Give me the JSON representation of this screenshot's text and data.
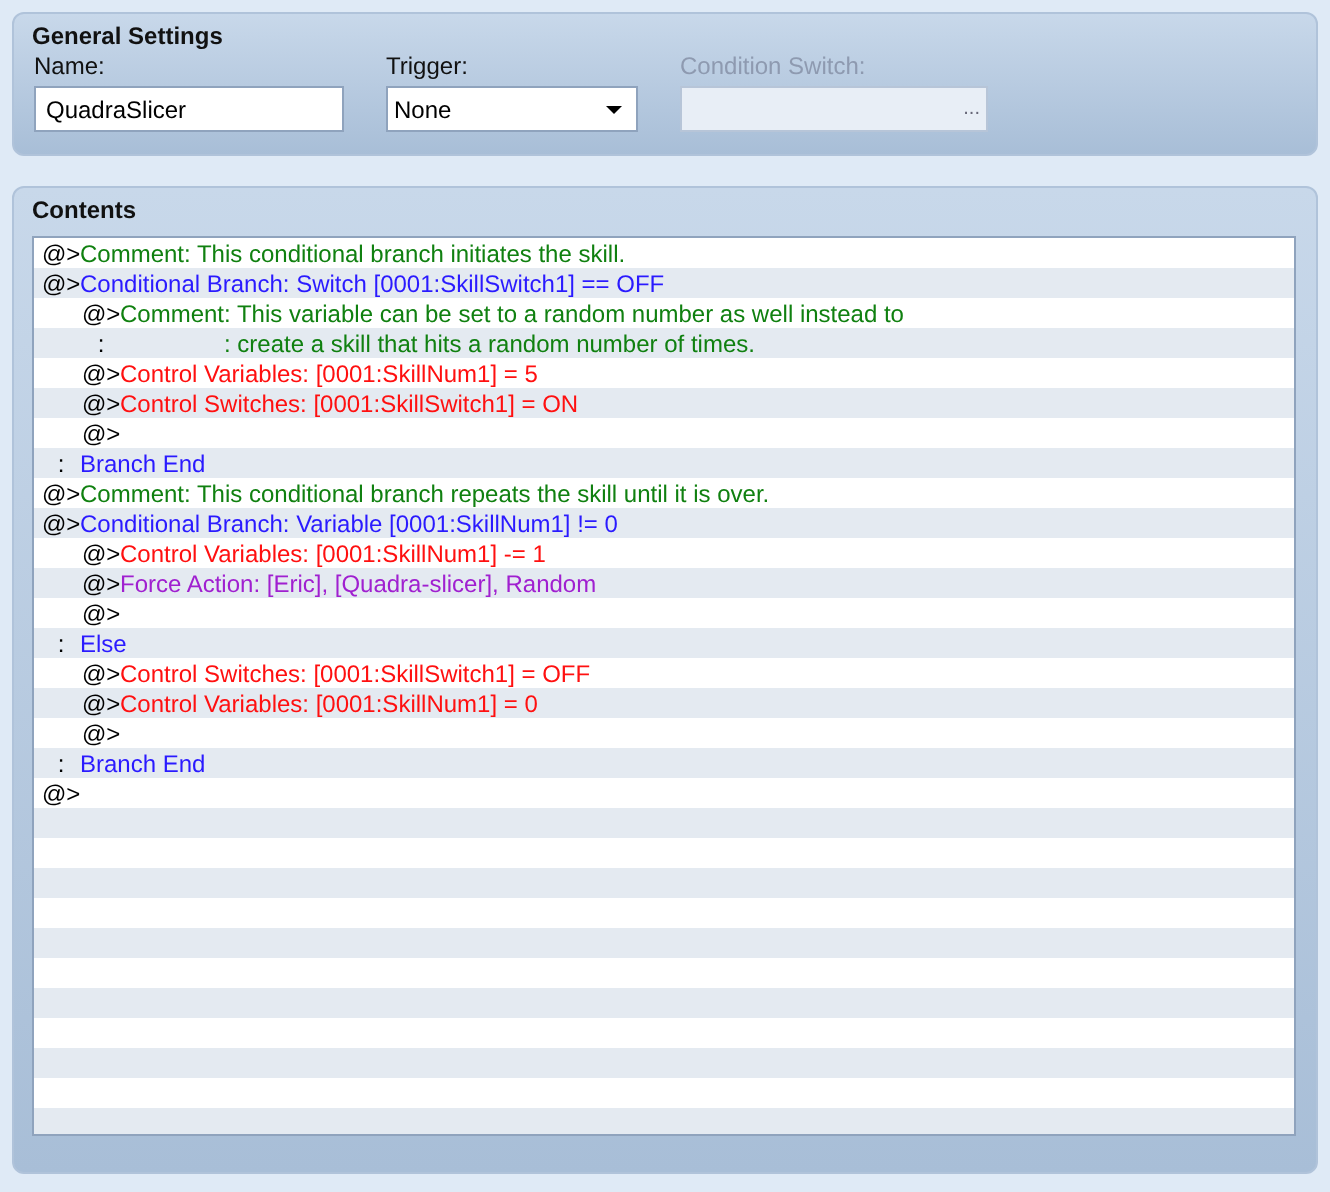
{
  "general_settings": {
    "title": "General Settings",
    "name": {
      "label": "Name:",
      "value": "QuadraSlicer"
    },
    "trigger": {
      "label": "Trigger:",
      "value": "None"
    },
    "condition_switch": {
      "label": "Condition Switch:",
      "button": "...",
      "disabled": true
    }
  },
  "contents": {
    "title": "Contents",
    "commands": [
      {
        "kind": "comment",
        "marker": "@>",
        "text": "Comment: This conditional branch initiates the skill."
      },
      {
        "kind": "branch",
        "marker": "@>",
        "text": "Conditional Branch: Switch [0001:SkillSwitch1] == OFF",
        "children": [
          {
            "kind": "comment",
            "marker": "@>",
            "text": "Comment: This variable can be set to a random number as well instead to",
            "continuation": {
              "marker": ":",
              "text": ": create a skill that hits a random number of times."
            }
          },
          {
            "kind": "control",
            "marker": "@>",
            "text": "Control Variables: [0001:SkillNum1] = 5"
          },
          {
            "kind": "control",
            "marker": "@>",
            "text": "Control Switches: [0001:SkillSwitch1] = ON"
          },
          {
            "kind": "empty",
            "marker": "@>"
          }
        ]
      },
      {
        "kind": "branch_end",
        "marker": ":",
        "text": "Branch End"
      },
      {
        "kind": "comment",
        "marker": "@>",
        "text": "Comment: This conditional branch repeats the skill until it is over."
      },
      {
        "kind": "branch",
        "marker": "@>",
        "text": "Conditional Branch: Variable [0001:SkillNum1] != 0",
        "children": [
          {
            "kind": "control",
            "marker": "@>",
            "text": "Control Variables: [0001:SkillNum1] -= 1"
          },
          {
            "kind": "action",
            "marker": "@>",
            "text": "Force Action: [Eric], [Quadra-slicer], Random"
          },
          {
            "kind": "empty",
            "marker": "@>"
          }
        ]
      },
      {
        "kind": "else",
        "marker": ":",
        "text": "Else",
        "children": [
          {
            "kind": "control",
            "marker": "@>",
            "text": "Control Switches: [0001:SkillSwitch1] = OFF"
          },
          {
            "kind": "control",
            "marker": "@>",
            "text": "Control Variables: [0001:SkillNum1] = 0"
          },
          {
            "kind": "empty",
            "marker": "@>"
          }
        ]
      },
      {
        "kind": "branch_end",
        "marker": ":",
        "text": "Branch End"
      },
      {
        "kind": "empty",
        "marker": "@>"
      }
    ]
  }
}
